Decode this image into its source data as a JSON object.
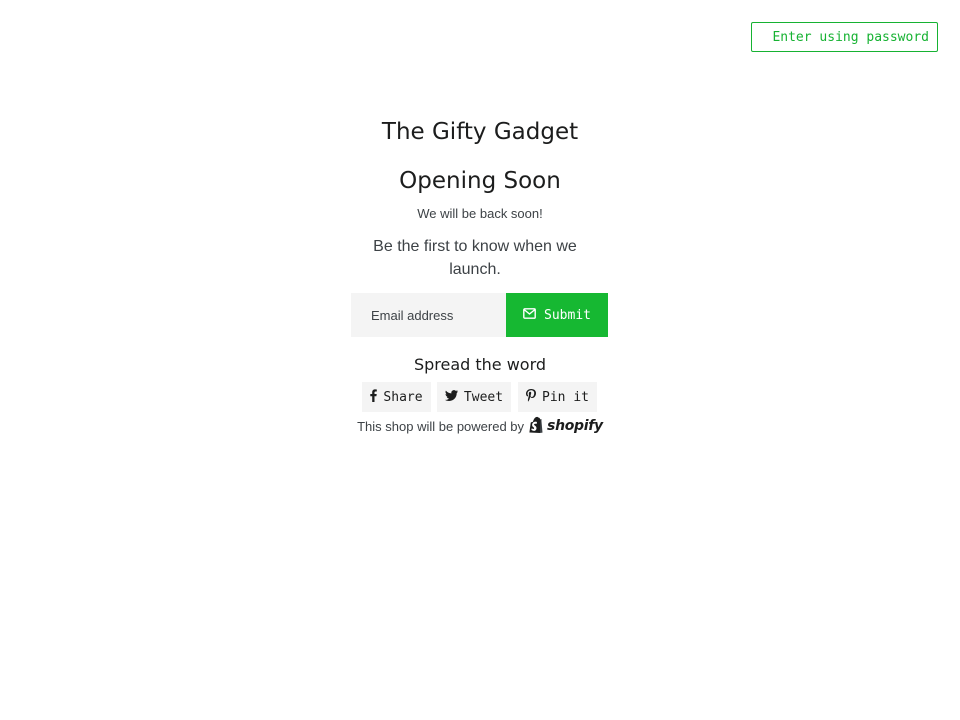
{
  "header": {
    "password_button_label": "Enter using password"
  },
  "main": {
    "shop_name": "The Gifty Gadget",
    "heading": "Opening Soon",
    "message": "We will be back soon!",
    "signup_text": "Be the first to know when we launch."
  },
  "form": {
    "email_placeholder": "Email address",
    "email_value": "",
    "submit_label": "Submit",
    "submit_icon": "envelope-icon"
  },
  "social": {
    "title": "Spread the word",
    "share_label": "Share",
    "share_icon": "facebook-icon",
    "tweet_label": "Tweet",
    "tweet_icon": "twitter-icon",
    "pin_label": "Pin it",
    "pin_icon": "pinterest-icon"
  },
  "footer": {
    "powered_text": "This shop will be powered by",
    "brand": "shopify",
    "brand_icon": "shopify-bag-icon"
  },
  "colors": {
    "accent": "#16b832",
    "text": "#1c1d1d",
    "muted": "#3d4246",
    "field_bg": "#f4f4f4"
  }
}
